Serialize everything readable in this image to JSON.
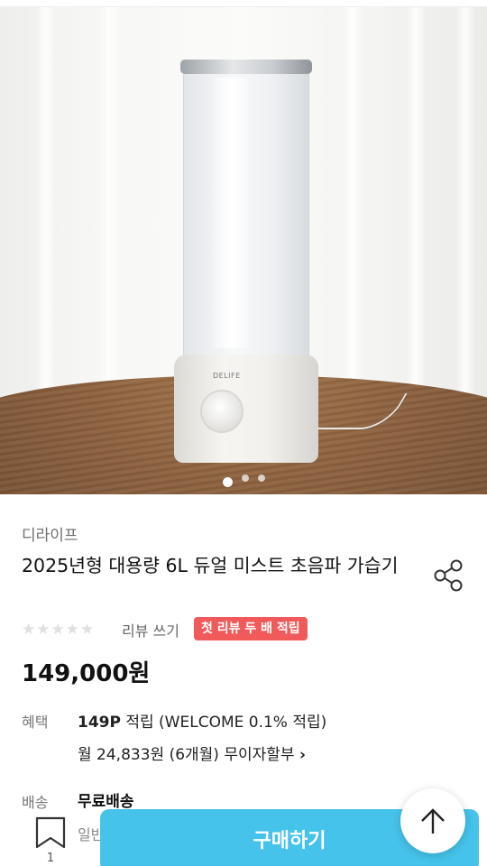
{
  "product": {
    "brand": "디라이프",
    "title": "2025년형 대용량 6L 듀얼 미스트 초음파 가습기",
    "device_logo": "DELIFE",
    "rating": {
      "stars_filled": 0,
      "stars_total": 5,
      "review_link": "리뷰 쓰기"
    },
    "badge": "첫 리뷰 두 배 적립",
    "price": "149,000원",
    "image_carousel": {
      "current": 1,
      "total": 3
    }
  },
  "benefit": {
    "label": "혜택",
    "points": "149P",
    "points_suffix": " 적립 (WELCOME 0.1% 적립)",
    "installment": "월 24,833원 (6개월) 무이자할부",
    "installment_chevron": "›"
  },
  "shipping": {
    "label": "배송",
    "value": "무료배송",
    "sub": "일반"
  },
  "bottom_bar": {
    "bookmark_count": "1",
    "buy_label": "구매하기"
  },
  "icons": [
    "share-icon",
    "bookmark-icon",
    "arrow-up-icon",
    "star-icon"
  ],
  "colors": {
    "buy_button": "#45c3ea",
    "badge": "#f05a5a",
    "brand_text": "#6e6e6e"
  }
}
